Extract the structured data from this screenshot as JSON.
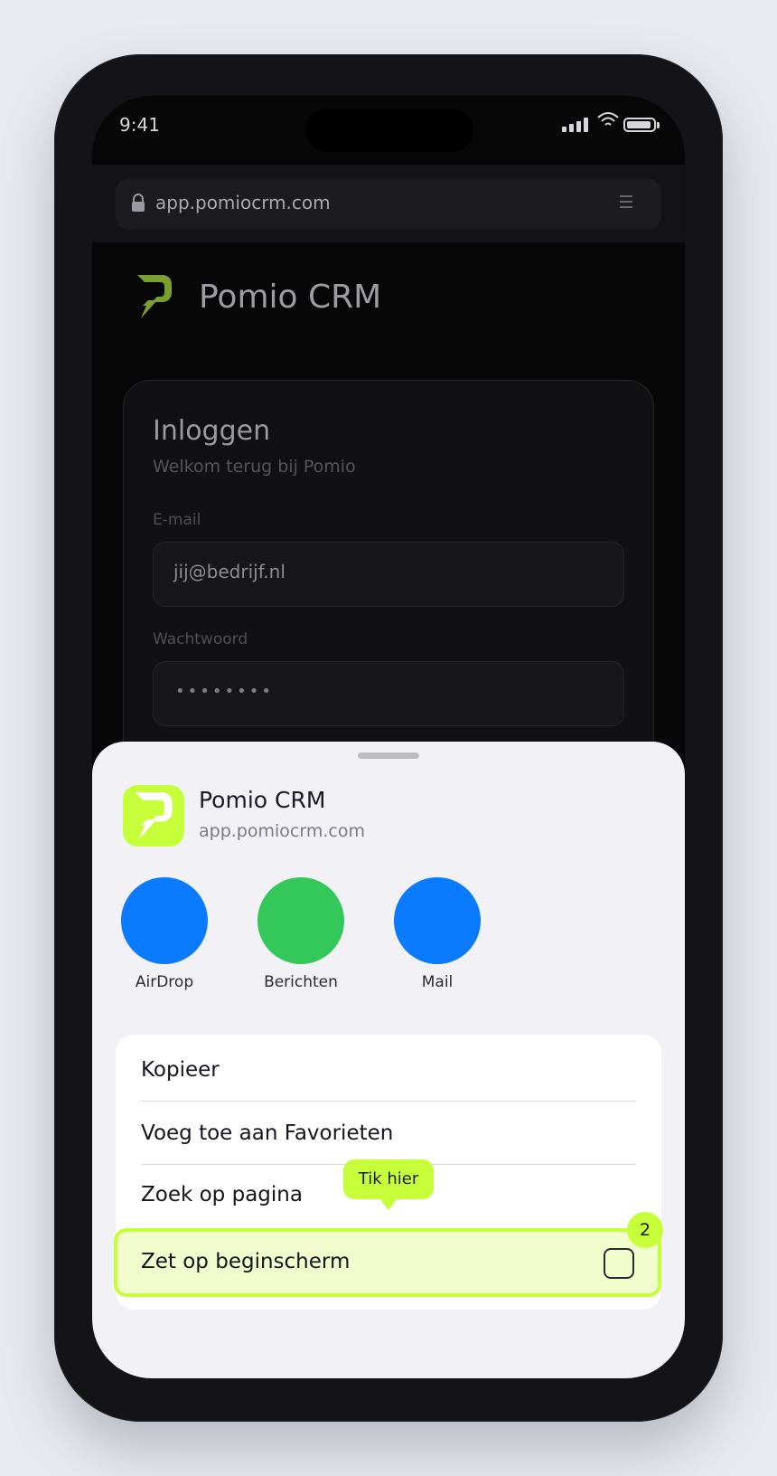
{
  "status_bar": {
    "time": "9:41"
  },
  "browser": {
    "url": "app.pomiocrm.com"
  },
  "brand": {
    "name": "Pomio CRM"
  },
  "login": {
    "title": "Inloggen",
    "subtitle": "Welkom terug bij Pomio",
    "email_label": "E-mail",
    "email_value": "jij@bedrijf.nl",
    "password_label": "Wachtwoord",
    "password_value": "••••••••"
  },
  "share_sheet": {
    "app_title": "Pomio CRM",
    "app_url": "app.pomiocrm.com",
    "targets": [
      {
        "label": "AirDrop",
        "color": "#0a7aff"
      },
      {
        "label": "Berichten",
        "color": "#34c759"
      },
      {
        "label": "Mail",
        "color": "#0a7aff"
      }
    ],
    "actions": [
      {
        "label": "Kopieer"
      },
      {
        "label": "Voeg toe aan Favorieten"
      },
      {
        "label": "Zoek op pagina"
      },
      {
        "label": "Zet op beginscherm"
      }
    ],
    "tooltip": "Tik hier",
    "step_badge": "2"
  },
  "colors": {
    "accent": "#c6ff3a",
    "highlight_bg": "#f1fdcc",
    "phone_frame": "#141418",
    "sheet_bg": "#f1f1f6"
  }
}
